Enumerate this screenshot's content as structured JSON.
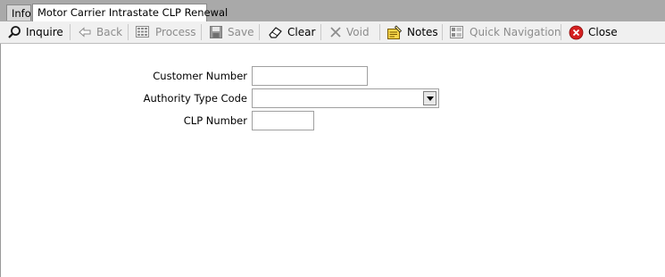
{
  "tabs": [
    {
      "label": "Info"
    },
    {
      "label": "Motor Carrier Intrastate CLP Renewal"
    }
  ],
  "toolbar": {
    "inquire": "Inquire",
    "back": "Back",
    "process": "Process",
    "save": "Save",
    "clear": "Clear",
    "void": "Void",
    "notes": "Notes",
    "quick_navigation": "Quick Navigation",
    "close": "Close"
  },
  "form": {
    "customer_number_label": "Customer Number",
    "customer_number_value": "",
    "authority_type_code_label": "Authority Type Code",
    "authority_type_code_value": "",
    "clp_number_label": "CLP Number",
    "clp_number_value": ""
  },
  "colors": {
    "tab_strip": "#a9a9a9",
    "toolbar": "#f0f0f0",
    "disabled_text": "#8c8c8c",
    "close_icon": "#d42020"
  }
}
